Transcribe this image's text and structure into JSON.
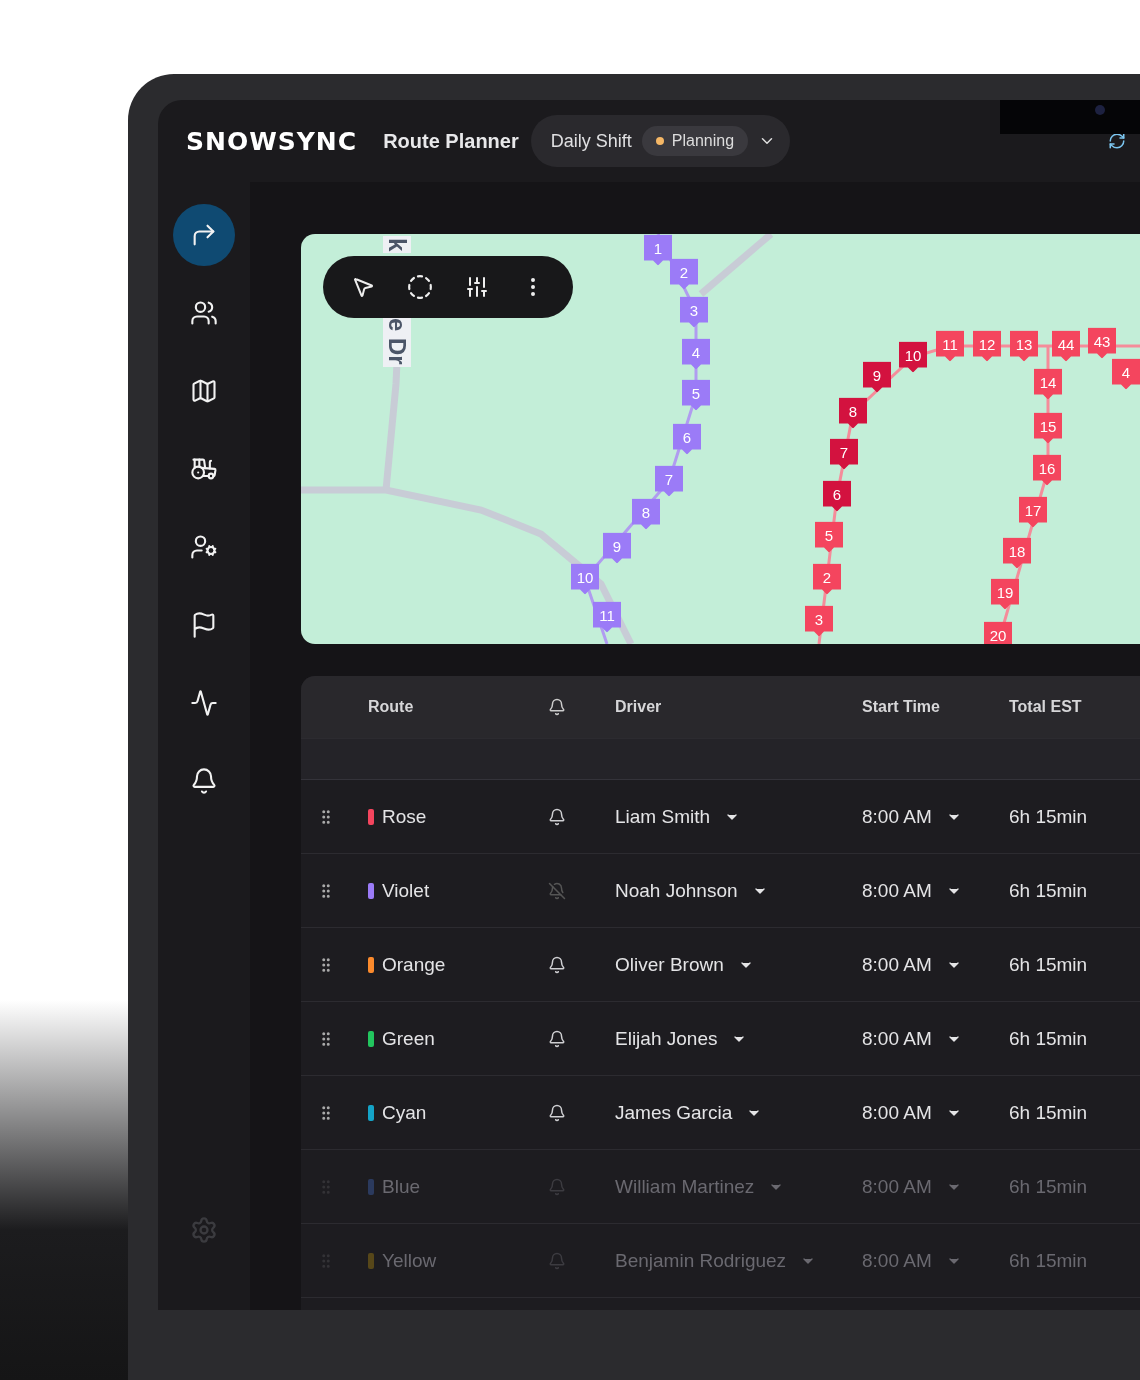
{
  "header": {
    "logo": "SNOWSYNC",
    "title": "Route Planner",
    "shift": {
      "label": "Daily Shift",
      "status": "Planning"
    }
  },
  "sidebar": {
    "items": [
      {
        "kind": "routes",
        "selected": true
      },
      {
        "kind": "drivers",
        "selected": false
      },
      {
        "kind": "map",
        "selected": false
      },
      {
        "kind": "vehicles",
        "selected": false
      },
      {
        "kind": "user-settings",
        "selected": false
      },
      {
        "kind": "flags",
        "selected": false
      },
      {
        "kind": "analytics",
        "selected": false
      },
      {
        "kind": "alerts",
        "selected": false
      }
    ]
  },
  "map": {
    "street_labels": [
      "k",
      "e Dr"
    ],
    "routes": [
      {
        "color": "#9b7bf7",
        "markers": [
          {
            "label": "1",
            "highlighted": false
          },
          {
            "label": "2",
            "highlighted": false
          },
          {
            "label": "3",
            "highlighted": false
          },
          {
            "label": "4",
            "highlighted": false
          },
          {
            "label": "5",
            "highlighted": false
          },
          {
            "label": "6",
            "highlighted": false
          },
          {
            "label": "7",
            "highlighted": false
          },
          {
            "label": "8",
            "highlighted": false
          },
          {
            "label": "9",
            "highlighted": false
          },
          {
            "label": "10",
            "highlighted": false
          },
          {
            "label": "11",
            "highlighted": false
          }
        ]
      },
      {
        "color": "#f4455e",
        "markers": [
          {
            "label": "10",
            "highlighted": true
          },
          {
            "label": "9",
            "highlighted": true
          },
          {
            "label": "8",
            "highlighted": true
          },
          {
            "label": "7",
            "highlighted": true
          },
          {
            "label": "6",
            "highlighted": true
          },
          {
            "label": "5",
            "highlighted": false
          },
          {
            "label": "2",
            "highlighted": false
          },
          {
            "label": "3",
            "highlighted": false
          },
          {
            "label": "11",
            "highlighted": false
          },
          {
            "label": "12",
            "highlighted": false
          },
          {
            "label": "13",
            "highlighted": false
          },
          {
            "label": "44",
            "highlighted": false
          },
          {
            "label": "43",
            "highlighted": false
          },
          {
            "label": "4",
            "highlighted": false
          },
          {
            "label": "14",
            "highlighted": false
          },
          {
            "label": "15",
            "highlighted": false
          },
          {
            "label": "16",
            "highlighted": false
          },
          {
            "label": "17",
            "highlighted": false
          },
          {
            "label": "18",
            "highlighted": false
          },
          {
            "label": "19",
            "highlighted": false
          },
          {
            "label": "20",
            "highlighted": false
          }
        ]
      }
    ]
  },
  "table": {
    "columns": [
      "Route",
      "Driver",
      "Start Time",
      "Total EST"
    ],
    "rows": [
      {
        "route": "Rose",
        "color": "#f4455e",
        "notify": true,
        "driver": "Liam Smith",
        "start": "8:00 AM",
        "total": "6h 15min",
        "dimmed": false
      },
      {
        "route": "Violet",
        "color": "#9b7bf7",
        "notify": false,
        "driver": "Noah Johnson",
        "start": "8:00 AM",
        "total": "6h 15min",
        "dimmed": false
      },
      {
        "route": "Orange",
        "color": "#fb8a2c",
        "notify": true,
        "driver": "Oliver Brown",
        "start": "8:00 AM",
        "total": "6h 15min",
        "dimmed": false
      },
      {
        "route": "Green",
        "color": "#22c55e",
        "notify": true,
        "driver": "Elijah Jones",
        "start": "8:00 AM",
        "total": "6h 15min",
        "dimmed": false
      },
      {
        "route": "Cyan",
        "color": "#14a3c7",
        "notify": true,
        "driver": "James Garcia",
        "start": "8:00 AM",
        "total": "6h 15min",
        "dimmed": false
      },
      {
        "route": "Blue",
        "color": "#2b3a5e",
        "notify": true,
        "driver": "William Martinez",
        "start": "8:00 AM",
        "total": "6h 15min",
        "dimmed": true
      },
      {
        "route": "Yellow",
        "color": "#574719",
        "notify": true,
        "driver": "Benjamin Rodriguez",
        "start": "8:00 AM",
        "total": "6h 15min",
        "dimmed": true
      }
    ]
  }
}
